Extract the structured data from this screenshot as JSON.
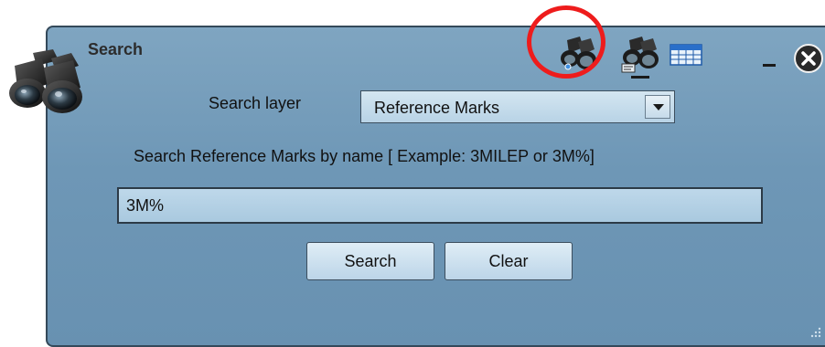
{
  "window": {
    "title": "Search"
  },
  "toolbar": {
    "icons": [
      "search-by-name-icon",
      "search-by-attribute-icon",
      "table-icon"
    ],
    "highlight_color": "#ee1c1c"
  },
  "form": {
    "layer_label": "Search layer",
    "layer_selected": "Reference Marks",
    "help_text": "Search Reference Marks by name  [ Example: 3MILEP or 3M%]",
    "query_value": "3M%"
  },
  "buttons": {
    "search_label": "Search",
    "clear_label": "Clear"
  },
  "colors": {
    "panel_background": "#7fa5c1",
    "panel_border": "#34495a",
    "input_background": "#bed8ea"
  }
}
